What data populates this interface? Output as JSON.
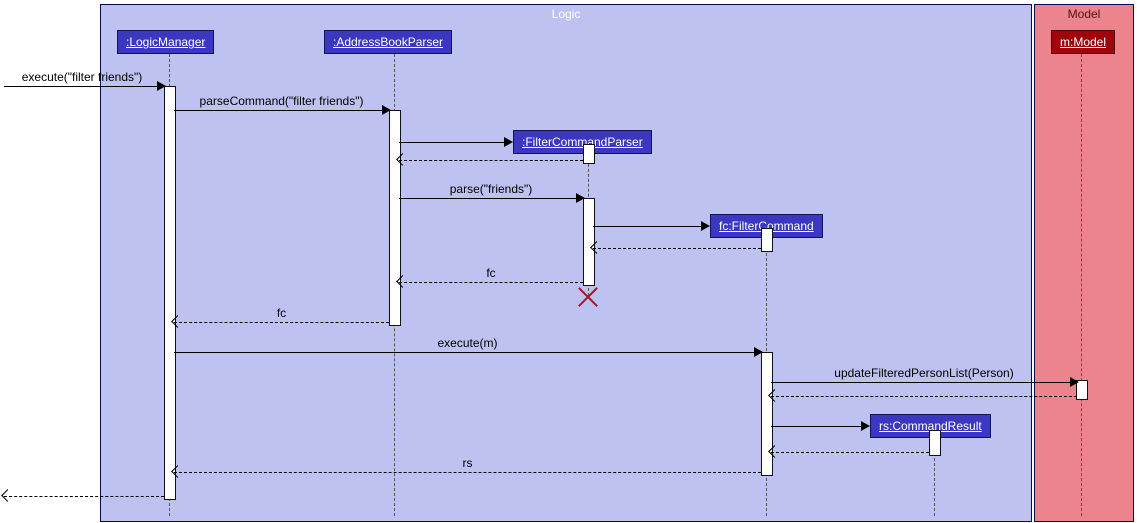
{
  "frames": {
    "logic": "Logic",
    "model": "Model"
  },
  "participants": {
    "logicManager": ":LogicManager",
    "abParser": ":AddressBookParser",
    "fcParser": ":FilterCommandParser",
    "filterCommand": "fc:FilterCommand",
    "commandResult": "rs:CommandResult",
    "model": "m:Model"
  },
  "messages": {
    "execute": "execute(\"filter friends\")",
    "parseCommand": "parseCommand(\"filter friends\")",
    "parseFriends": "parse(\"friends\")",
    "fc1": "fc",
    "fc2": "fc",
    "executeM": "execute(m)",
    "updateList": "updateFilteredPersonList(Person)",
    "rs": "rs"
  },
  "chart_data": {
    "type": "diagram-sequence",
    "frames": [
      {
        "name": "Logic",
        "contains": [
          ":LogicManager",
          ":AddressBookParser",
          ":FilterCommandParser",
          "fc:FilterCommand",
          "rs:CommandResult"
        ]
      },
      {
        "name": "Model",
        "contains": [
          "m:Model"
        ]
      }
    ],
    "messages": [
      {
        "from": "caller",
        "to": ":LogicManager",
        "label": "execute(\"filter friends\")",
        "type": "sync"
      },
      {
        "from": ":LogicManager",
        "to": ":AddressBookParser",
        "label": "parseCommand(\"filter friends\")",
        "type": "sync"
      },
      {
        "from": ":AddressBookParser",
        "to": ":FilterCommandParser",
        "label": "",
        "type": "create"
      },
      {
        "from": ":FilterCommandParser",
        "to": ":AddressBookParser",
        "label": "",
        "type": "return"
      },
      {
        "from": ":AddressBookParser",
        "to": ":FilterCommandParser",
        "label": "parse(\"friends\")",
        "type": "sync"
      },
      {
        "from": ":FilterCommandParser",
        "to": "fc:FilterCommand",
        "label": "",
        "type": "create"
      },
      {
        "from": "fc:FilterCommand",
        "to": ":FilterCommandParser",
        "label": "",
        "type": "return"
      },
      {
        "from": ":FilterCommandParser",
        "to": ":AddressBookParser",
        "label": "fc",
        "type": "return"
      },
      {
        "from": ":FilterCommandParser",
        "to": ":FilterCommandParser",
        "label": "",
        "type": "destroy"
      },
      {
        "from": ":AddressBookParser",
        "to": ":LogicManager",
        "label": "fc",
        "type": "return"
      },
      {
        "from": ":LogicManager",
        "to": "fc:FilterCommand",
        "label": "execute(m)",
        "type": "sync"
      },
      {
        "from": "fc:FilterCommand",
        "to": "m:Model",
        "label": "updateFilteredPersonList(Person)",
        "type": "sync"
      },
      {
        "from": "m:Model",
        "to": "fc:FilterCommand",
        "label": "",
        "type": "return"
      },
      {
        "from": "fc:FilterCommand",
        "to": "rs:CommandResult",
        "label": "",
        "type": "create"
      },
      {
        "from": "rs:CommandResult",
        "to": "fc:FilterCommand",
        "label": "",
        "type": "return"
      },
      {
        "from": "fc:FilterCommand",
        "to": ":LogicManager",
        "label": "rs",
        "type": "return"
      },
      {
        "from": ":LogicManager",
        "to": "caller",
        "label": "",
        "type": "return"
      }
    ]
  }
}
